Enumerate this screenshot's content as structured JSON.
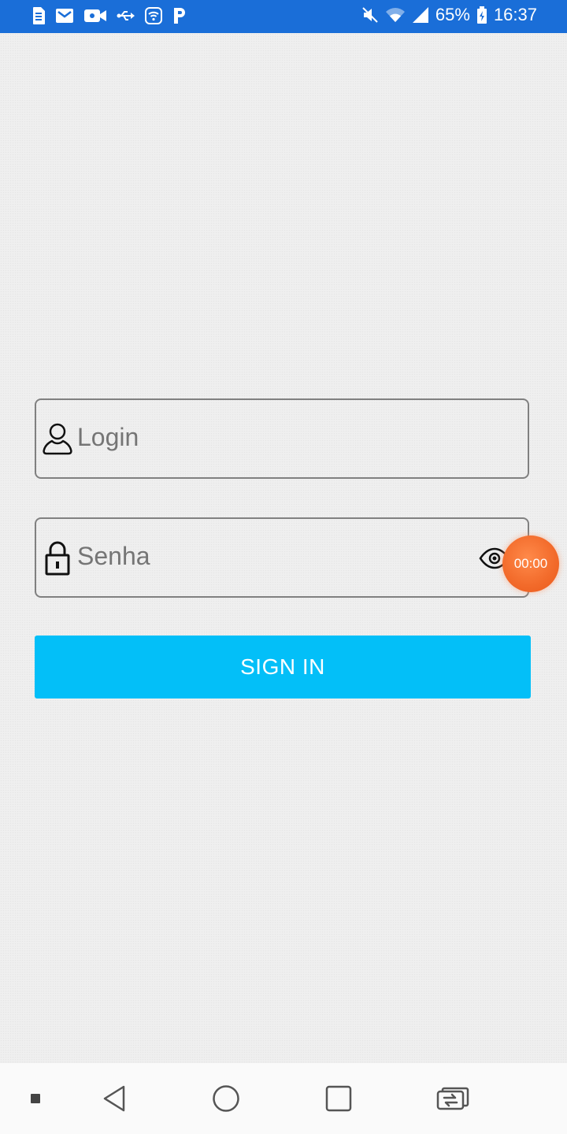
{
  "status_bar": {
    "battery_percent": "65%",
    "time": "16:37",
    "icons_left": [
      "sim-card-icon",
      "mail-icon",
      "video-icon",
      "usb-icon",
      "wifi-square-icon",
      "p-app-icon"
    ],
    "icons_right": [
      "mute-icon",
      "wifi-icon",
      "signal-icon",
      "battery-charging-icon"
    ],
    "background": "#1a6ed8"
  },
  "login_form": {
    "login_placeholder": "Login",
    "password_placeholder": "Senha",
    "sign_in_label": "SIGN IN",
    "accent_color": "#03bff8"
  },
  "timer_bubble": {
    "time": "00:00",
    "color": "#f26a2a"
  },
  "nav_bar": {
    "items": [
      "menu-dot-icon",
      "back-icon",
      "home-icon",
      "recents-icon",
      "switch-app-icon"
    ]
  }
}
